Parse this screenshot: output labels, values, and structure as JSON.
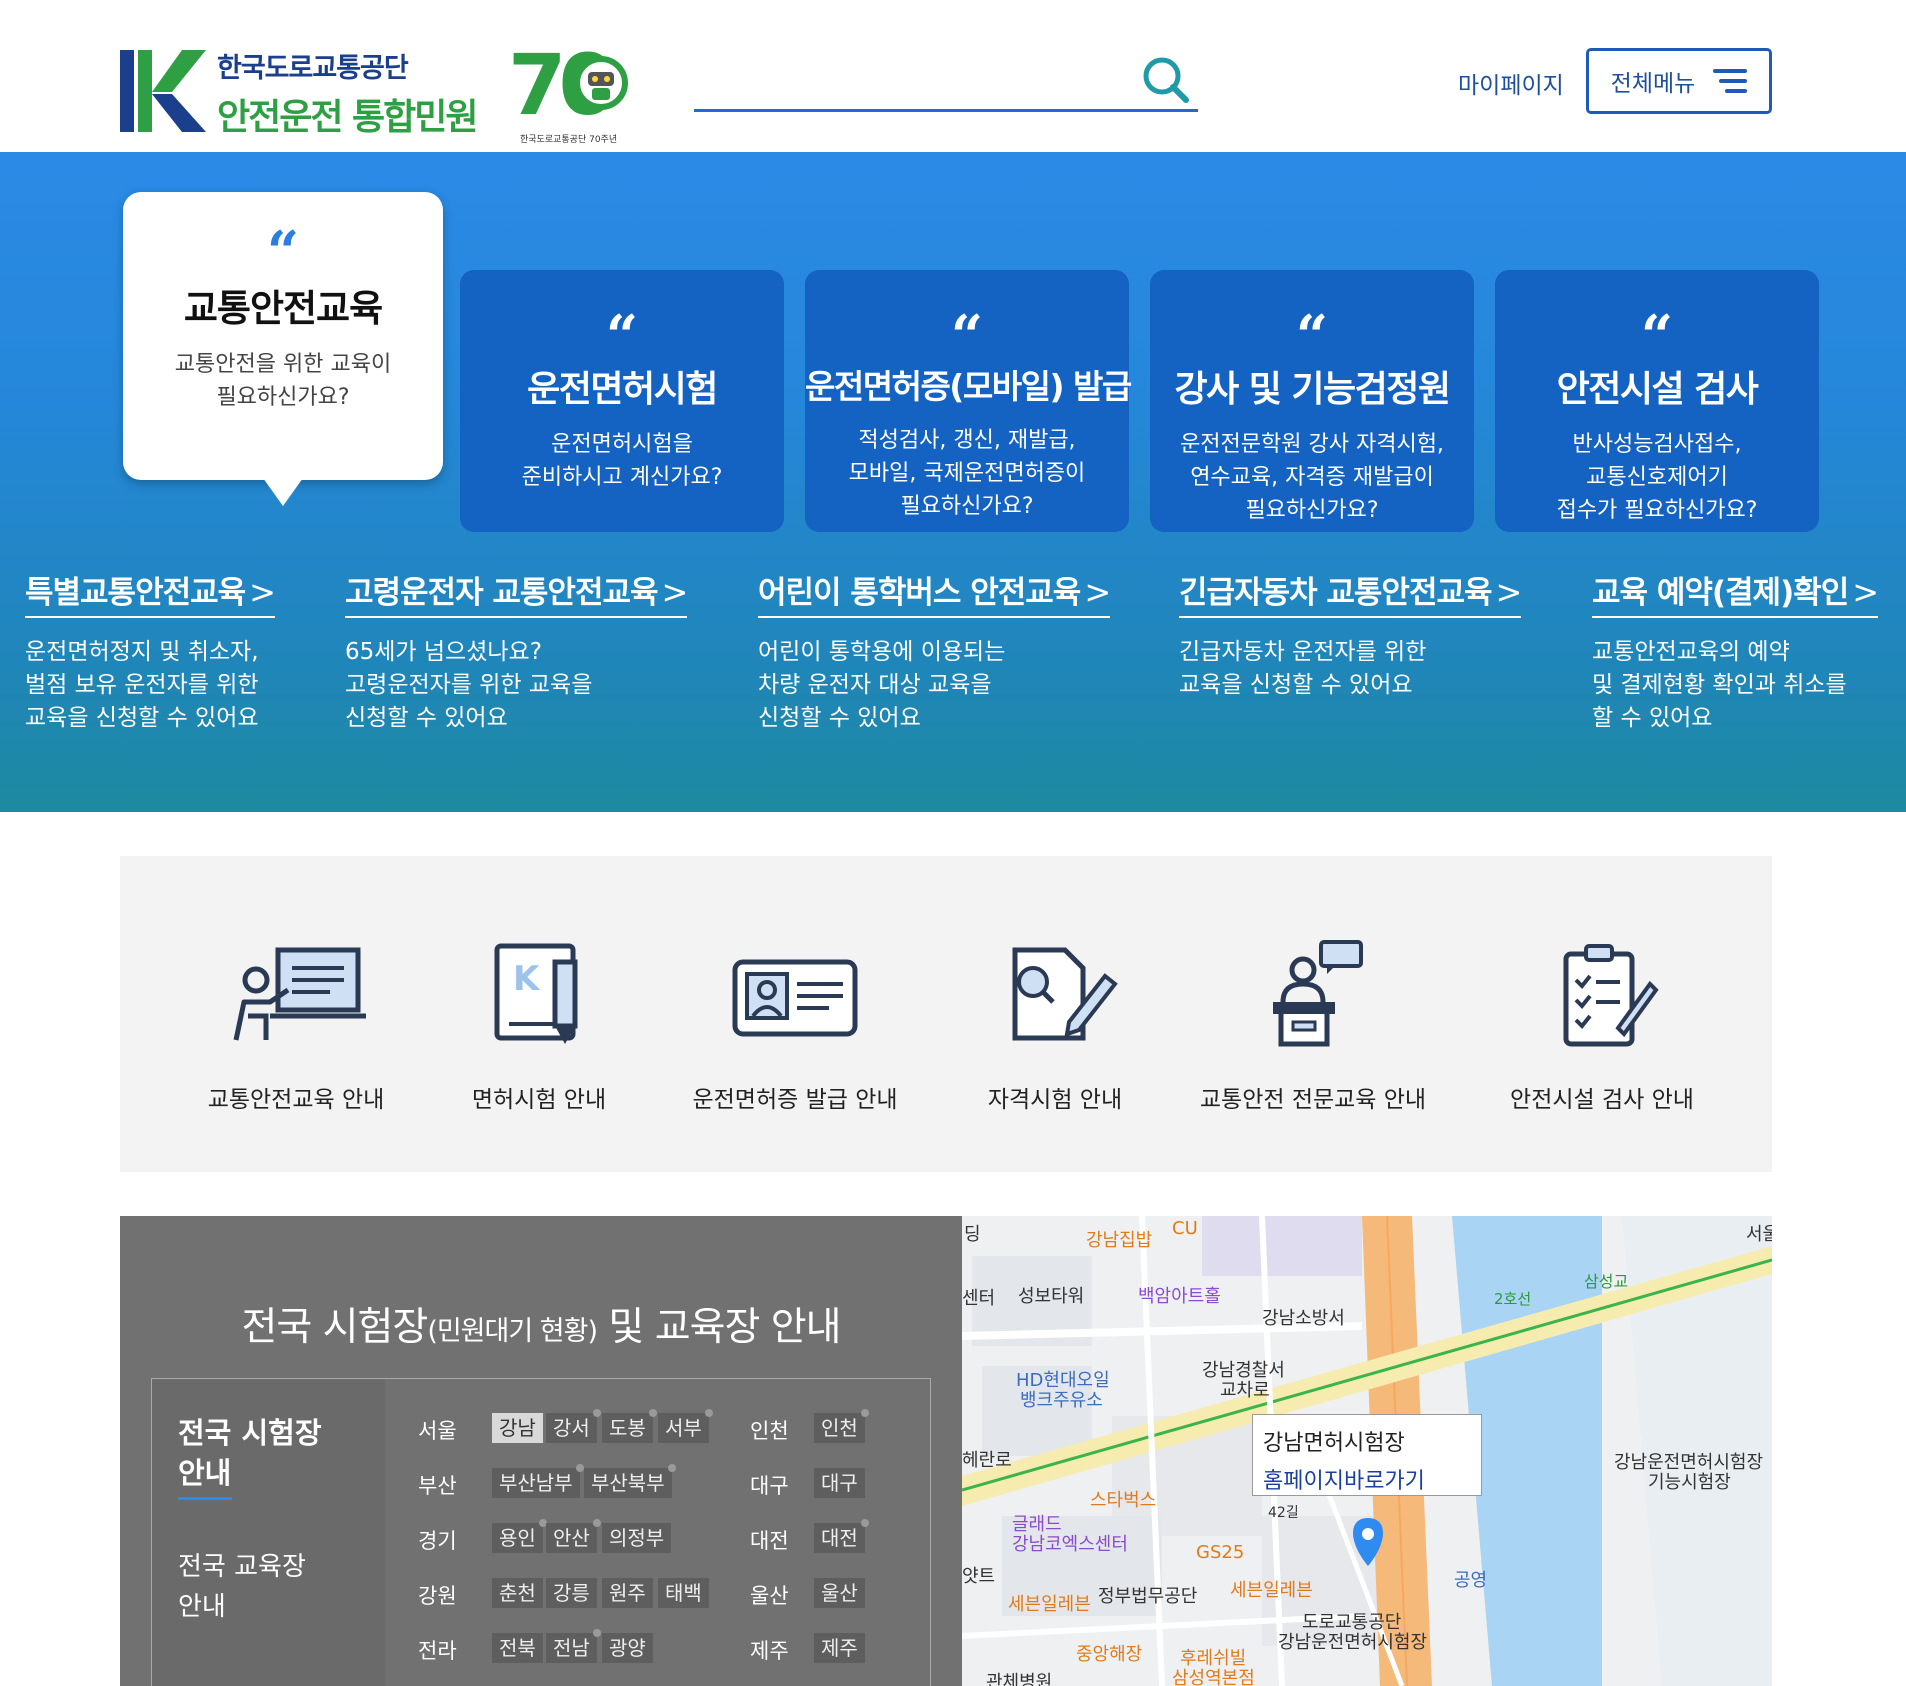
{
  "header": {
    "logo_line1": "한국도로교통공단",
    "logo_line2": "안전운전 통합민원",
    "logo_70": "70",
    "logo_70_sub": "한국도로교통공단 70주년",
    "search_placeholder": "",
    "mypage_label": "마이페이지",
    "allmenu_label": "전체메뉴"
  },
  "hero": {
    "bubble": {
      "quote": "“",
      "title": "교통안전교육",
      "desc": [
        "교통안전을 위한 교육이",
        "필요하신가요?"
      ]
    },
    "cards": [
      {
        "quote": "“",
        "title": "운전면허시험",
        "desc": [
          "운전면허시험을",
          "준비하시고 계신가요?"
        ]
      },
      {
        "quote": "“",
        "title": "운전면허증(모바일) 발급",
        "desc": [
          "적성검사, 갱신, 재발급,",
          "모바일, 국제운전면허증이",
          "필요하신가요?"
        ]
      },
      {
        "quote": "“",
        "title": "강사 및 기능검정원",
        "desc": [
          "운전전문학원 강사 자격시험,",
          "연수교육, 자격증 재발급이",
          "필요하신가요?"
        ]
      },
      {
        "quote": "“",
        "title": "안전시설 검사",
        "desc": [
          "반사성능검사접수,",
          "교통신호제어기",
          "접수가 필요하신가요?"
        ]
      }
    ],
    "edu_links": [
      {
        "title": "특별교통안전교육",
        "arrow": ">",
        "desc": [
          "운전면허정지 및 취소자,",
          "벌점 보유 운전자를 위한",
          "교육을 신청할 수 있어요"
        ]
      },
      {
        "title": "고령운전자 교통안전교육",
        "arrow": ">",
        "desc": [
          "65세가 넘으셨나요?",
          "고령운전자를 위한 교육을",
          "신청할 수 있어요"
        ]
      },
      {
        "title": "어린이 통학버스 안전교육",
        "arrow": ">",
        "desc": [
          "어린이 통학용에 이용되는",
          "차량 운전자 대상 교육을",
          "신청할 수 있어요"
        ]
      },
      {
        "title": "긴급자동차 교통안전교육",
        "arrow": ">",
        "desc": [
          "긴급자동차 운전자를 위한",
          "교육을 신청할 수 있어요"
        ]
      },
      {
        "title": "교육 예약(결제)확인",
        "arrow": ">",
        "desc": [
          "교통안전교육의 예약",
          "및 결제현황 확인과 취소를",
          "할 수 있어요"
        ]
      }
    ]
  },
  "quick_links": [
    {
      "label": "교통안전교육 안내",
      "icon": "teacher-board-icon"
    },
    {
      "label": "면허시험 안내",
      "icon": "book-pencil-icon"
    },
    {
      "label": "운전면허증 발급 안내",
      "icon": "id-card-icon"
    },
    {
      "label": "자격시험 안내",
      "icon": "document-pen-icon"
    },
    {
      "label": "교통안전 전문교육 안내",
      "icon": "lecturer-podium-icon"
    },
    {
      "label": "안전시설 검사 안내",
      "icon": "clipboard-checklist-icon"
    }
  ],
  "centers": {
    "title_main1": "전국 시험장",
    "title_small": "(민원대기 현황)",
    "title_main2": " 및 교육장 안내",
    "tab_active_line1": "전국 시험장",
    "tab_active_line2": "안내",
    "tab_other_line1": "전국 교육장",
    "tab_other_line2": "안내",
    "left_regions": [
      {
        "name": "서울",
        "sites": [
          "강남",
          "강서",
          "도봉",
          "서부"
        ]
      },
      {
        "name": "부산",
        "sites": [
          "부산남부",
          "부산북부"
        ]
      },
      {
        "name": "경기",
        "sites": [
          "용인",
          "안산",
          "의정부"
        ]
      },
      {
        "name": "강원",
        "sites": [
          "춘천",
          "강릉",
          "원주",
          "태백"
        ]
      },
      {
        "name": "전라",
        "sites": [
          "전북",
          "전남",
          "광양"
        ]
      }
    ],
    "right_regions": [
      {
        "name": "인천",
        "sites": [
          "인천"
        ]
      },
      {
        "name": "대구",
        "sites": [
          "대구"
        ]
      },
      {
        "name": "대전",
        "sites": [
          "대전"
        ]
      },
      {
        "name": "울산",
        "sites": [
          "울산"
        ]
      },
      {
        "name": "제주",
        "sites": [
          "제주"
        ]
      }
    ],
    "active_site": "강남"
  },
  "map": {
    "popup_title": "강남면허시험장",
    "popup_link": "홈페이지바로가기",
    "labels": {
      "l1": "딩",
      "l2": "강남집밥",
      "l3": "CU",
      "l4": "서울",
      "l5": "센터",
      "l6": "성보타워",
      "l7": "백암아트홀",
      "l8": "강남소방서",
      "l9": "2호선",
      "l10": "삼성교",
      "l11": "HD현대오일",
      "l12": "뱅크주유소",
      "l13": "강남경찰서",
      "l14": "교차로",
      "l15": "헤란로",
      "l16": "스타벅스",
      "l17": "글래드",
      "l18": "강남코엑스센터",
      "l19": "GS25",
      "l20": "강남운전면허시험장",
      "l21": "기능시험장",
      "l22": "얏트",
      "l23": "세븐일레븐",
      "l24": "정부법무공단",
      "l25": "세븐일레븐",
      "l26": "공영",
      "l27": "도로교통공단",
      "l28": "강남운전면허시험장",
      "l29": "중앙해장",
      "l30": "후레쉬빌",
      "l31": "삼성역본점",
      "l32": "관체병원",
      "l33": "42길"
    }
  },
  "colors": {
    "brand_blue": "#1e5bb8",
    "brand_green": "#2ea043",
    "hero_card": "#1462c2",
    "link_blue": "#1b3ea5"
  }
}
